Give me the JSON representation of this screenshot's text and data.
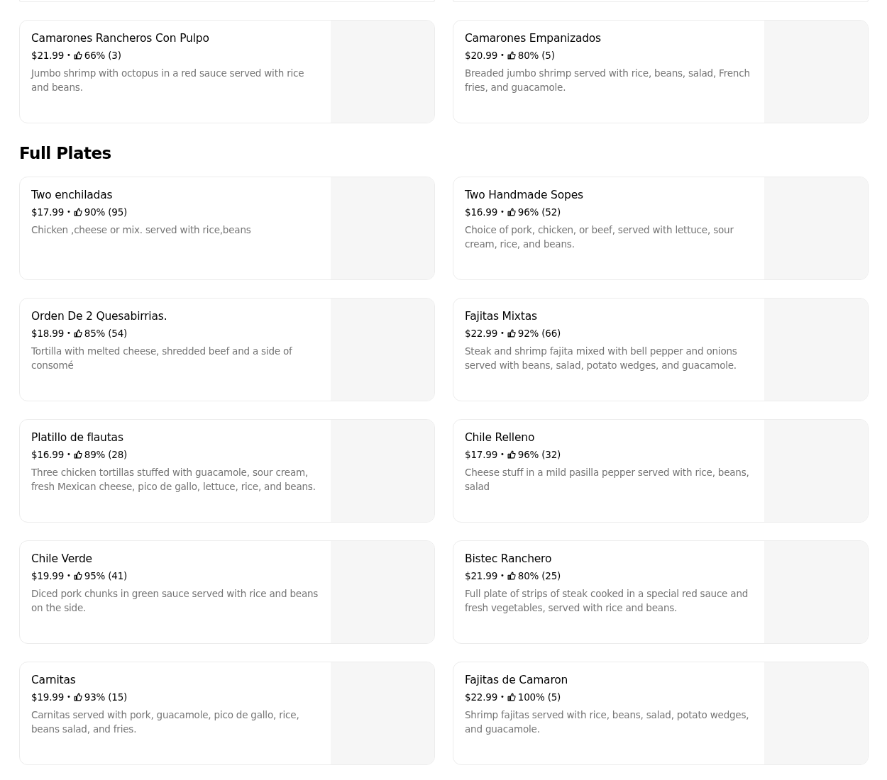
{
  "sections": [
    {
      "items": [
        {
          "name": "Camarones Rancheros Con Pulpo",
          "price": "$21.99",
          "separator": "•",
          "rating": "66% (3)",
          "description": "Jumbo shrimp with octopus in a red sauce served with rice and beans."
        },
        {
          "name": "Camarones Empanizados",
          "price": "$20.99",
          "separator": "•",
          "rating": "80% (5)",
          "description": "Breaded jumbo shrimp served with rice, beans, salad, French fries, and guacamole."
        }
      ]
    },
    {
      "title": "Full Plates",
      "items": [
        {
          "name": "Two enchiladas",
          "price": "$17.99",
          "separator": "•",
          "rating": "90% (95)",
          "description": "Chicken ,cheese or mix. served with rice,beans"
        },
        {
          "name": "Two Handmade Sopes",
          "price": "$16.99",
          "separator": "•",
          "rating": "96% (52)",
          "description": "Choice of pork, chicken, or beef, served with lettuce, sour cream, rice, and beans."
        },
        {
          "name": "Orden De  2 Quesabirrias.",
          "price": "$18.99",
          "separator": "•",
          "rating": "85% (54)",
          "description": "Tortilla with melted cheese, shredded beef and a side of consomé"
        },
        {
          "name": "Fajitas Mixtas",
          "price": "$22.99",
          "separator": "•",
          "rating": "92% (66)",
          "description": "Steak and shrimp fajita mixed with bell pepper and onions served with beans, salad, potato wedges, and guacamole."
        },
        {
          "name": "Platillo de flautas",
          "price": "$16.99",
          "separator": "•",
          "rating": "89% (28)",
          "description": "Three chicken tortillas stuffed with guacamole, sour cream, fresh Mexican cheese, pico de gallo, lettuce, rice, and beans."
        },
        {
          "name": "Chile Relleno",
          "price": "$17.99",
          "separator": "•",
          "rating": "96% (32)",
          "description": "Cheese stuff in a mild pasilla pepper served with rice, beans, salad"
        },
        {
          "name": "Chile Verde",
          "price": "$19.99",
          "separator": "•",
          "rating": "95% (41)",
          "description": "Diced pork chunks in green sauce served with rice and beans on the side."
        },
        {
          "name": "Bistec Ranchero",
          "price": "$21.99",
          "separator": "•",
          "rating": "80% (25)",
          "description": "Full plate of strips of steak cooked in a special red sauce and fresh vegetables, served with rice and beans."
        },
        {
          "name": "Carnitas",
          "price": "$19.99",
          "separator": "•",
          "rating": "93% (15)",
          "description": "Carnitas served with pork, guacamole, pico de gallo, rice, beans salad, and fries."
        },
        {
          "name": "Fajitas de Camaron",
          "price": "$22.99",
          "separator": "•",
          "rating": "100% (5)",
          "description": "Shrimp fajitas served with rice, beans, salad, potato wedges, and guacamole."
        }
      ]
    }
  ]
}
